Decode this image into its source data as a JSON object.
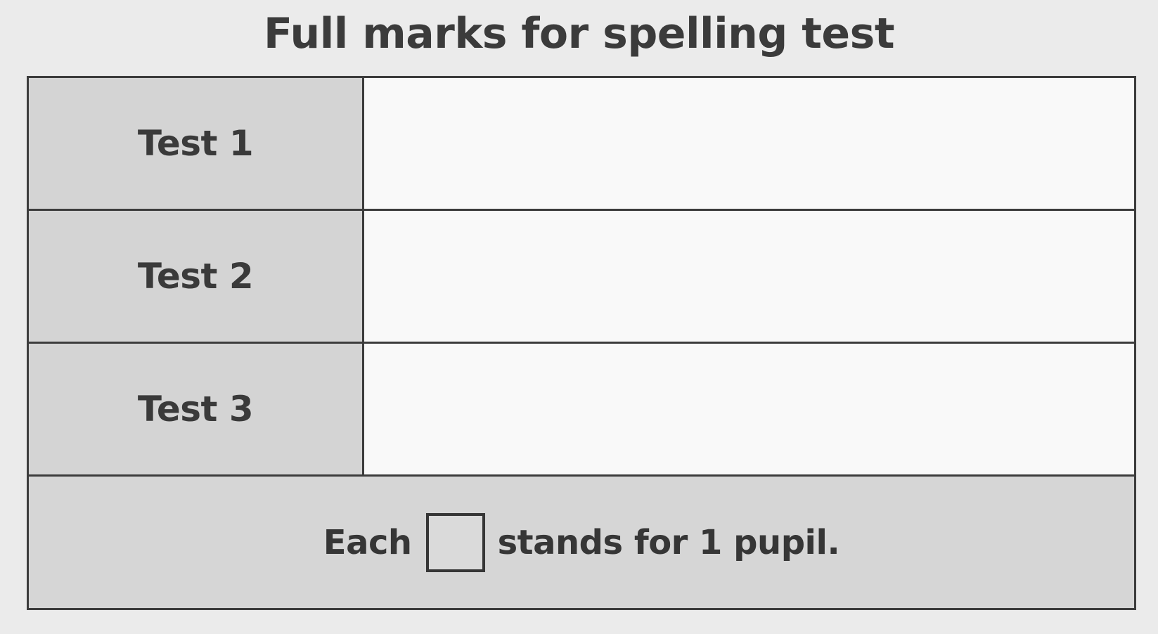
{
  "title": "Full marks for spelling test",
  "rows": [
    {
      "label": "Test 1"
    },
    {
      "label": "Test 2"
    },
    {
      "label": "Test 3"
    }
  ],
  "key": {
    "before": "Each",
    "symbol": "square-symbol",
    "after": "stands for 1 pupil."
  },
  "colors": {
    "label_shading": "#d4d4d4",
    "data_cell": "#f9f9f9",
    "border": "#3c3c3c"
  }
}
